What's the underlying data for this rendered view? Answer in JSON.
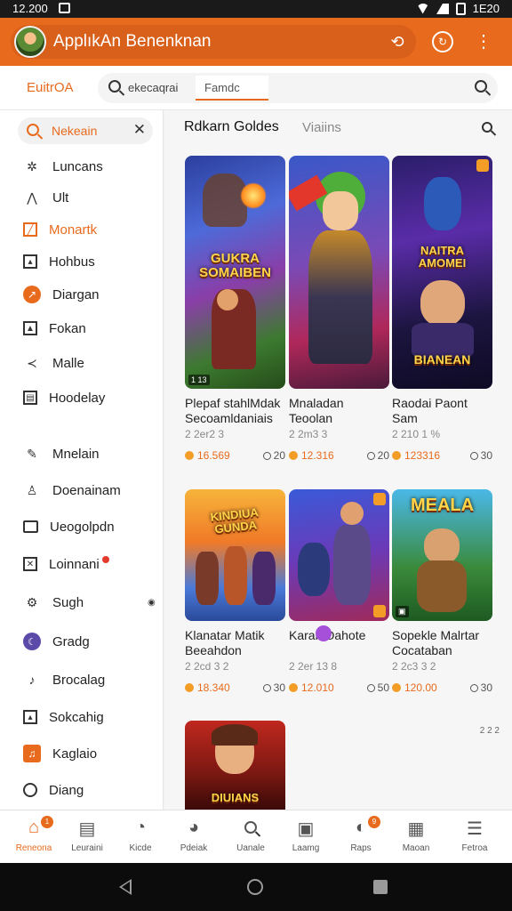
{
  "status_bar": {
    "time": "12.200",
    "right_text": "1E20"
  },
  "app_bar": {
    "title": "ApplıkAn Benenknan"
  },
  "search_row": {
    "brand": "EuitrOA",
    "query": "ekecaqrai",
    "chip": "Famdc"
  },
  "sidebar": {
    "search_label": "Nekeain",
    "items": [
      {
        "label": "Luncans",
        "icon": "sparkle-icon"
      },
      {
        "label": "Ult",
        "icon": "arrow-up-icon"
      },
      {
        "label": "Monartk",
        "icon": "square-slash-icon",
        "active": true
      },
      {
        "label": "Hohbus",
        "icon": "image-icon"
      },
      {
        "label": "Diargan",
        "icon": "compass-icon"
      },
      {
        "label": "Fokan",
        "icon": "picture-icon"
      },
      {
        "label": "Malle",
        "icon": "share-icon"
      },
      {
        "label": "Hoodelay",
        "icon": "calendar-icon"
      },
      {
        "label": "Mnelain",
        "icon": "pencil-icon"
      },
      {
        "label": "Doenainam",
        "icon": "person-icon"
      },
      {
        "label": "Ueogolpdn",
        "icon": "briefcase-icon"
      },
      {
        "label": "Loinnani",
        "icon": "crossed-swords-icon",
        "dot": true
      },
      {
        "label": "Sugh",
        "icon": "chip-icon"
      },
      {
        "label": "Gradg",
        "icon": "moon-icon"
      },
      {
        "label": "Brocalag",
        "icon": "leaf-icon"
      },
      {
        "label": "Sokcahig",
        "icon": "gallery-icon"
      },
      {
        "label": "Kaglaio",
        "icon": "music-icon"
      },
      {
        "label": "Diang",
        "icon": "circle-icon"
      }
    ]
  },
  "main": {
    "heading": "Rdkarn Goldes",
    "heading2": "Viaiins",
    "cards": [
      {
        "title": "Plepaf stahlMdak Secoamldaniais",
        "meta": "2 2er2 3",
        "price": "16.569",
        "count": "20",
        "logo": "GUKRA SOMAIBEN",
        "badge": "1 13"
      },
      {
        "title": "Mnaladan Teoolan",
        "meta": "2 2m3 3",
        "price": "12.316",
        "count": "20"
      },
      {
        "title": "Raodai Paont Sam",
        "meta": "2 210 1 %",
        "price": "123316",
        "count": "30",
        "logo": "NAITRA AMOMEI",
        "logo2": "BIANEAN"
      },
      {
        "title": "Klanatar Matik Beeahdon",
        "meta": "2 2cd 3 2",
        "price": "18.340",
        "count": "30",
        "logo": "KINDIUA GUNDA"
      },
      {
        "title": "Karak Oahote",
        "meta": "2 2er 13 8",
        "price": "12.010",
        "count": "50"
      },
      {
        "title": "Sopekle Malrtar Cocataban",
        "meta": "2 2c3 3 2",
        "price": "120.00",
        "count": "30",
        "logo": "MEALA"
      },
      {
        "logo": "DIUIANS"
      }
    ],
    "corner_text": "2 2 2"
  },
  "bottom_nav": [
    {
      "label": "Reneona",
      "icon": "home-icon",
      "active": true,
      "badge": "1"
    },
    {
      "label": "Leuraini",
      "icon": "document-icon"
    },
    {
      "label": "Kicde",
      "icon": "wrench-icon"
    },
    {
      "label": "Pdeiak",
      "icon": "compass-icon"
    },
    {
      "label": "Uanale",
      "icon": "search-icon"
    },
    {
      "label": "Laamg",
      "icon": "card-icon"
    },
    {
      "label": "Raps",
      "icon": "tag-icon",
      "badge": "9"
    },
    {
      "label": "Maoan",
      "icon": "building-icon"
    },
    {
      "label": "Fetroa",
      "icon": "menu-icon"
    }
  ]
}
